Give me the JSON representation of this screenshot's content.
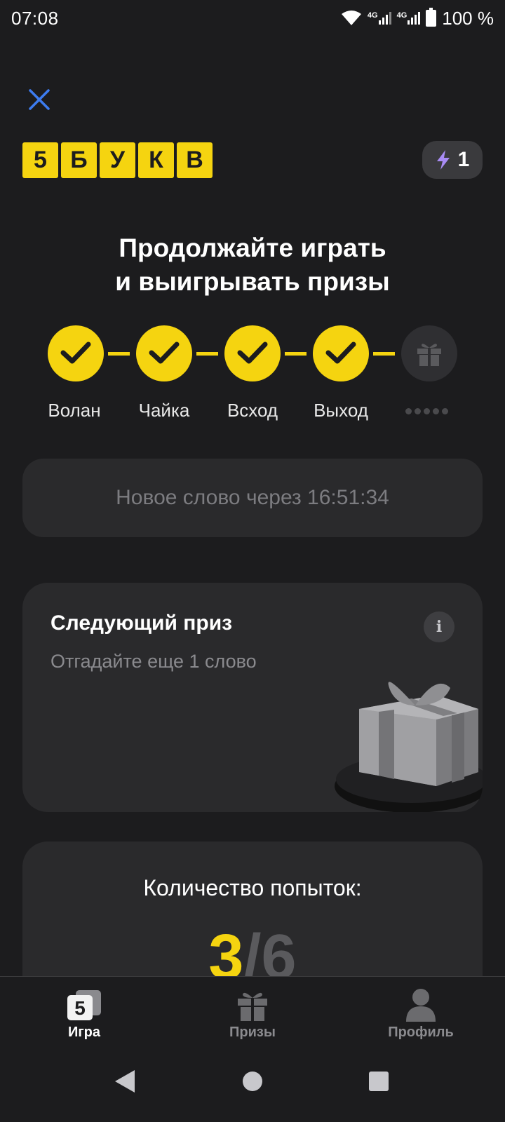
{
  "status_bar": {
    "time": "07:08",
    "network_1": "4G",
    "network_2": "4G",
    "battery": "100 %"
  },
  "header": {
    "close_icon": "close-icon",
    "logo_letters": [
      "5",
      "Б",
      "У",
      "К",
      "В"
    ],
    "energy_count": "1",
    "energy_icon": "lightning-icon"
  },
  "headline": {
    "line1": "Продолжайте играть",
    "line2": "и выигрывать призы"
  },
  "progress": {
    "steps": [
      {
        "label": "Волан",
        "done": true
      },
      {
        "label": "Чайка",
        "done": true
      },
      {
        "label": "Всход",
        "done": true
      },
      {
        "label": "Выход",
        "done": true
      },
      {
        "label": "",
        "done": false,
        "icon": "gift-icon"
      }
    ]
  },
  "timer": {
    "text": "Новое слово через 16:51:34"
  },
  "next_prize": {
    "title": "Следующий приз",
    "subtitle": "Отгадайте еще 1 слово",
    "info_label": "i"
  },
  "attempts": {
    "title": "Количество попыток:",
    "used": "3",
    "separator": "/",
    "total": "6"
  },
  "tabbar": {
    "tabs": [
      {
        "label": "Игра",
        "icon": "game-5-icon",
        "active": true
      },
      {
        "label": "Призы",
        "icon": "gift-icon",
        "active": false
      },
      {
        "label": "Профиль",
        "icon": "profile-icon",
        "active": false
      }
    ],
    "game_icon_text": "5"
  },
  "colors": {
    "background": "#1c1c1e",
    "accent": "#f5d410",
    "card": "#2a2a2c"
  }
}
